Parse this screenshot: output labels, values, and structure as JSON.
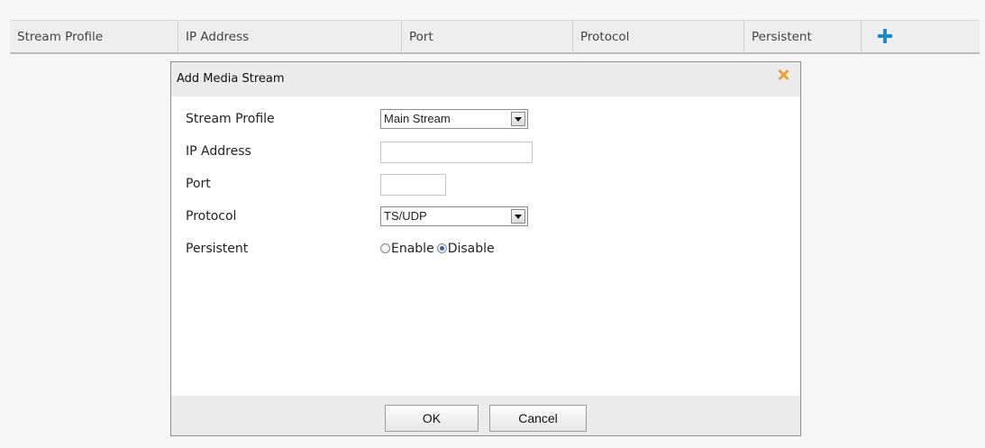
{
  "table": {
    "columns": {
      "stream_profile": "Stream Profile",
      "ip_address": "IP Address",
      "port": "Port",
      "protocol": "Protocol",
      "persistent": "Persistent"
    },
    "add_icon": "plus-icon"
  },
  "dialog": {
    "title": "Add Media Stream",
    "close_icon": "close-icon",
    "fields": {
      "stream_profile": {
        "label": "Stream Profile",
        "value": "Main Stream"
      },
      "ip_address": {
        "label": "IP Address",
        "value": ""
      },
      "port": {
        "label": "Port",
        "value": ""
      },
      "protocol": {
        "label": "Protocol",
        "value": "TS/UDP"
      },
      "persistent": {
        "label": "Persistent",
        "options": [
          "Enable",
          "Disable"
        ],
        "selected": "Disable"
      }
    },
    "buttons": {
      "ok": "OK",
      "cancel": "Cancel"
    }
  },
  "colors": {
    "accent_plus": "#1d8ac9",
    "close_x": "#e8a03c",
    "header_bg": "#eeeeee"
  }
}
